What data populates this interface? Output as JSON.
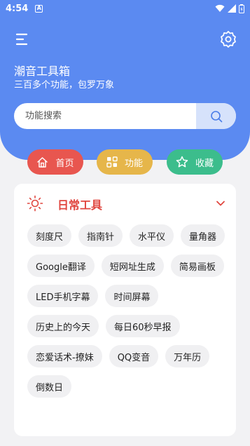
{
  "status_bar": {
    "time": "4:54",
    "notification_letter": "A"
  },
  "header": {
    "title": "潮音工具箱",
    "subtitle": "三百多个功能，包罗万象"
  },
  "search": {
    "placeholder": "功能搜索"
  },
  "nav_pills": [
    {
      "label": "首页",
      "icon": "home-icon",
      "color": "#e8564f"
    },
    {
      "label": "功能",
      "icon": "grid-icon",
      "color": "#e6b64a"
    },
    {
      "label": "收藏",
      "icon": "star-icon",
      "color": "#3cbd8c"
    }
  ],
  "section": {
    "title": "日常工具",
    "icon": "sun-icon",
    "items": [
      "刻度尺",
      "指南针",
      "水平仪",
      "量角器",
      "Google翻译",
      "短网址生成",
      "简易画板",
      "LED手机字幕",
      "时间屏幕",
      "历史上的今天",
      "每日60秒早报",
      "恋爱话术-撩妹",
      "QQ变音",
      "万年历",
      "倒数日"
    ]
  },
  "colors": {
    "primary": "#5b8af1",
    "accent_red": "#e0463f",
    "background": "#f2f2f4"
  }
}
